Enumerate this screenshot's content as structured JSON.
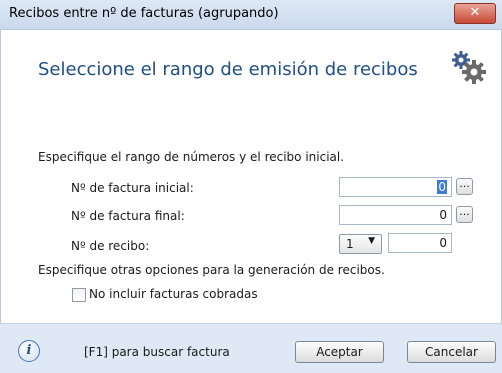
{
  "window": {
    "title": "Recibos entre nº de facturas (agrupando)",
    "close_glyph": "✕"
  },
  "header": {
    "title": "Seleccione el rango de emisión de recibos",
    "icon": "gears-icon"
  },
  "range_section": {
    "label": "Especifique el rango de números y el recibo inicial.",
    "invoice_start": {
      "label": "Nº de factura inicial:",
      "value": "0",
      "browse": "..."
    },
    "invoice_end": {
      "label": "Nº de factura final:",
      "value": "0",
      "browse": "..."
    },
    "receipt": {
      "label": "Nº de recibo:",
      "series": "1",
      "value": "0"
    }
  },
  "options_section": {
    "label": "Especifique otras opciones para la generación de recibos.",
    "exclude_paid": {
      "label": "No incluir facturas cobradas",
      "checked": false
    }
  },
  "footer": {
    "info_glyph": "i",
    "hint": "[F1] para buscar factura",
    "accept": "Aceptar",
    "cancel": "Cancelar"
  }
}
